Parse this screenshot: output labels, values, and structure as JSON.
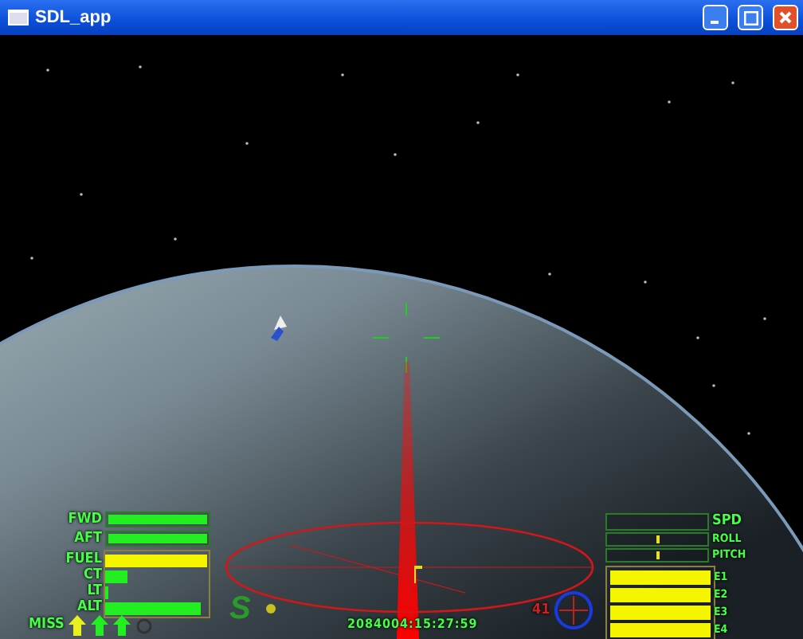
{
  "window": {
    "title": "SDL_app"
  },
  "left_gauges": [
    {
      "label": "FWD",
      "level": 1,
      "color": "#22ee22",
      "kind": "framed"
    },
    {
      "label": "AFT",
      "level": 1,
      "color": "#22ee22",
      "kind": "framed"
    },
    {
      "label": "FUEL",
      "level": 1,
      "color": "#f5f500",
      "kind": "boxed"
    },
    {
      "label": "CT",
      "level": 0.22,
      "color": "#22ee22",
      "kind": "boxed"
    },
    {
      "label": "LT",
      "level": 0.03,
      "color": "#22ee22",
      "kind": "boxed"
    },
    {
      "label": "ALT",
      "level": 0.94,
      "color": "#22ee22",
      "kind": "boxed"
    }
  ],
  "missiles": {
    "label": "MISS",
    "slots": [
      {
        "loaded": true,
        "selected": true
      },
      {
        "loaded": true,
        "selected": false
      },
      {
        "loaded": true,
        "selected": false
      },
      {
        "loaded": false,
        "selected": false
      }
    ]
  },
  "speed_letter": "S",
  "timestamp": "2084004:15:27:59",
  "target_distance": "41",
  "right_gauges": [
    {
      "label": "SPD",
      "kind": "bar",
      "level": 0
    },
    {
      "label": "ROLL",
      "kind": "marker",
      "level": 0.5
    },
    {
      "label": "PITCH",
      "kind": "marker",
      "level": 0.5
    }
  ],
  "engines": [
    {
      "label": "E1",
      "level": 1
    },
    {
      "label": "E2",
      "level": 1
    },
    {
      "label": "E3",
      "level": 1
    },
    {
      "label": "E4",
      "level": 1
    }
  ]
}
